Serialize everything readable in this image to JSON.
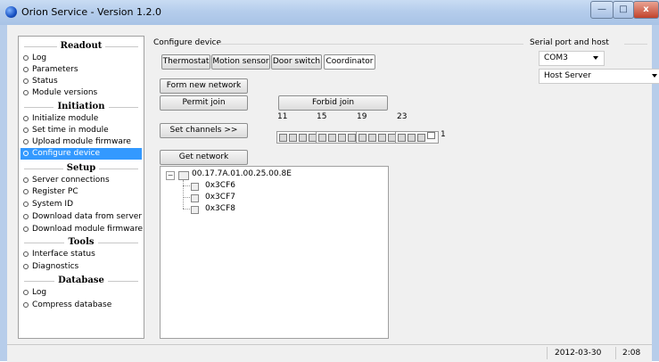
{
  "window": {
    "title": "Orion Service - Version 1.2.0",
    "min_glyph": "—",
    "max_glyph": "□",
    "close_glyph": "x"
  },
  "sidebar": {
    "sections": [
      {
        "title": "Readout",
        "items": [
          "Log",
          "Parameters",
          "Status",
          "Module versions"
        ]
      },
      {
        "title": "Initiation",
        "items": [
          "Initialize module",
          "Set time in module",
          "Upload module firmware",
          "Configure device"
        ]
      },
      {
        "title": "Setup",
        "items": [
          "Server connections",
          "Register PC",
          "System ID",
          "Download data from server",
          "Download module firmware"
        ]
      },
      {
        "title": "Tools",
        "items": [
          "Interface status",
          "Diagnostics"
        ]
      },
      {
        "title": "Database",
        "items": [
          "Log",
          "Compress database"
        ]
      }
    ],
    "selected": "Configure device"
  },
  "configure": {
    "group_label": "Configure device",
    "tabs": [
      "Thermostat",
      "Motion sensor",
      "Door switch",
      "Coordinator"
    ],
    "active_tab": "Coordinator",
    "form_new_network": "Form new network",
    "permit_join": "Permit join",
    "forbid_join": "Forbid join",
    "set_channels": "Set channels >>",
    "channel_numbers": [
      "11",
      "15",
      "19",
      "23"
    ],
    "channel_last": "1",
    "get_network": "Get network"
  },
  "tree": {
    "root": "00.17.7A.01.00.25.00.8E",
    "children": [
      "0x3CF6",
      "0x3CF7",
      "0x3CF8"
    ]
  },
  "serial": {
    "group_label": "Serial port and host",
    "port": "COM3",
    "host": "Host Server"
  },
  "status": {
    "date": "2012-03-30",
    "time": "2:08"
  }
}
